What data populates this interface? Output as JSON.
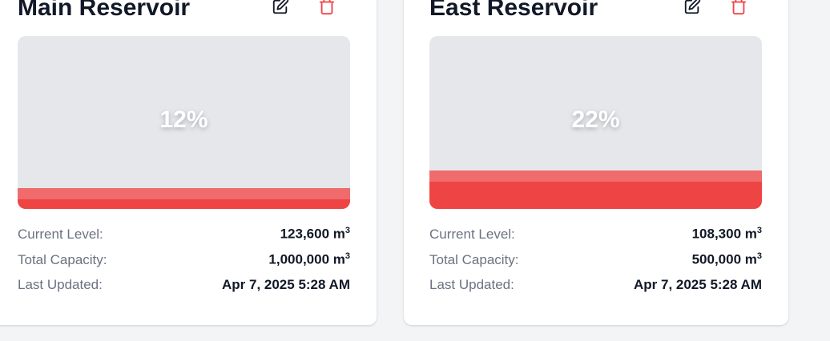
{
  "reservoirs": [
    {
      "name": "Main Reservoir",
      "percent_label": "12%",
      "fill_fraction": 0.12,
      "current_level_label": "Current Level:",
      "current_level": "123,600 m",
      "total_capacity_label": "Total Capacity:",
      "total_capacity": "1,000,000 m",
      "last_updated_label": "Last Updated:",
      "last_updated": "Apr 7, 2025 5:28 AM"
    },
    {
      "name": "East Reservoir",
      "percent_label": "22%",
      "fill_fraction": 0.22,
      "current_level_label": "Current Level:",
      "current_level": "108,300 m",
      "total_capacity_label": "Total Capacity:",
      "total_capacity": "500,000 m",
      "last_updated_label": "Last Updated:",
      "last_updated": "Apr 7, 2025 5:28 AM"
    }
  ],
  "unit_superscript": "3",
  "icons": {
    "edit": "edit-icon",
    "delete": "trash-icon"
  },
  "colors": {
    "water": "#ef4444",
    "water_surface": "#f06b6b",
    "tank": "#e5e7eb",
    "delete_icon": "#ef4444"
  }
}
